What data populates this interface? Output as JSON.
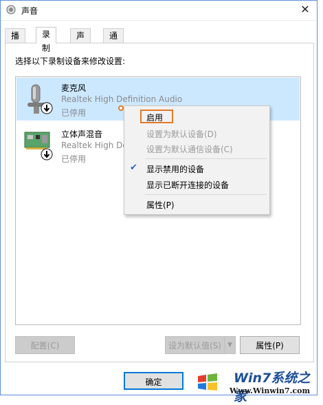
{
  "window": {
    "title": "声音",
    "close": "✕"
  },
  "tabs": [
    {
      "label": "播放"
    },
    {
      "label": "录制"
    },
    {
      "label": "声音"
    },
    {
      "label": "通信"
    }
  ],
  "instruction": "选择以下录制设备来修改设置:",
  "devices": [
    {
      "name": "麦克风",
      "driver": "Realtek High Definition Audio",
      "status": "已停用",
      "icon": "microphone-icon",
      "selected": true
    },
    {
      "name": "立体声混音",
      "driver": "Realtek High Definition Audio",
      "status": "已停用",
      "icon": "sound-card-icon",
      "selected": false
    }
  ],
  "context_menu": {
    "items": [
      {
        "label": "启用",
        "enabled": true,
        "highlighted": true
      },
      {
        "label": "设置为默认设备(D)",
        "enabled": false
      },
      {
        "label": "设置为默认通信设备(C)",
        "enabled": false
      },
      {
        "label": "显示禁用的设备",
        "enabled": true,
        "checked": true
      },
      {
        "label": "显示已断开连接的设备",
        "enabled": true
      },
      {
        "label": "属性(P)",
        "enabled": true
      }
    ]
  },
  "buttons": {
    "configure": "配置(C)",
    "set_default": "设为默认值(S)",
    "properties": "属性(P)",
    "ok": "确定"
  },
  "watermark": {
    "site": "Win7系统之家",
    "url": "Www.Winwin7.com"
  },
  "colors": {
    "selection": "#cce8ff",
    "highlight_box": "#e27a2a",
    "accent": "#0078d7"
  }
}
